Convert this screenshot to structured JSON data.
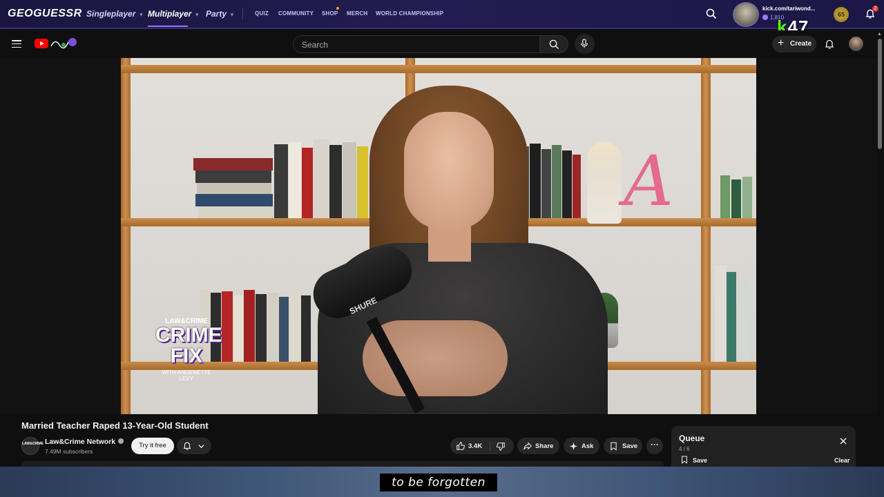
{
  "geoguessr": {
    "logo": "GEOGUESSR",
    "nav": [
      {
        "label": "Singleplayer"
      },
      {
        "label": "Multiplayer"
      },
      {
        "label": "Party"
      }
    ],
    "links": [
      "QUIZ",
      "COMMUNITY",
      "SHOP",
      "MERCH",
      "WORLD CHAMPIONSHIP"
    ],
    "user": "kick.com/tariwond...",
    "coins": "1,810",
    "level": "65",
    "notification_count": "2"
  },
  "kick_overlay": {
    "k": "k",
    "number": "47"
  },
  "youtube": {
    "search": {
      "placeholder": "Search"
    },
    "create_label": "Create"
  },
  "video": {
    "title": "Married Teacher Raped 13-Year-Old Student",
    "overlay_logo": {
      "top": "LAW&CRIME",
      "line1": "CRIME",
      "line2": "FIX",
      "with": "WITH ANGENETTE LEVY"
    },
    "mic_brand": "SHURE",
    "channel": {
      "avatar_text": "LAW&CRIME",
      "name": "Law&Crime Network",
      "subscribers": "7.49M subscribers"
    },
    "try_label": "Try it free",
    "actions": {
      "likes": "3.4K",
      "share": "Share",
      "ask": "Ask",
      "save": "Save",
      "more": "···"
    }
  },
  "queue": {
    "title": "Queue",
    "count": "4 / 6",
    "save": "Save",
    "clear": "Clear"
  },
  "subtitle": "to be forgotten",
  "colors": {
    "geo_bar": "#231c52",
    "yt_bg": "#0f0f0f",
    "yt_red": "#ff0000",
    "kick_green": "#53fc18",
    "shelf": "#b87a3c"
  }
}
